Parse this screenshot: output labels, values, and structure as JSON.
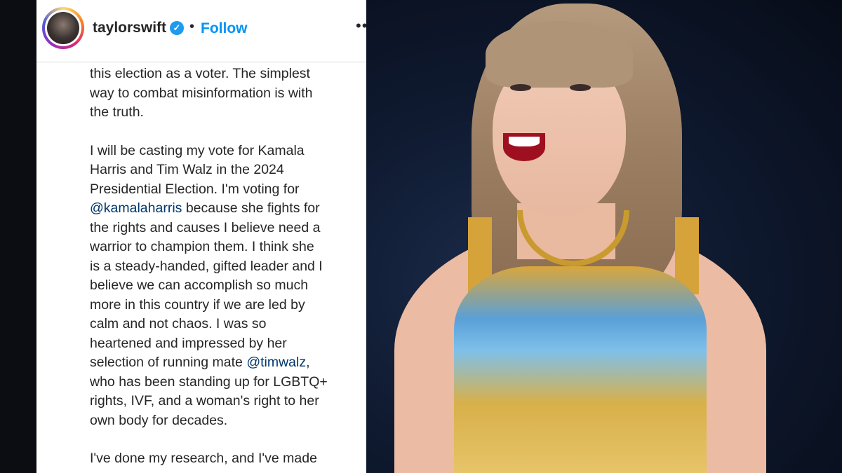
{
  "post": {
    "username": "taylorswift",
    "verified_icon": "verified-badge-icon",
    "separator": "•",
    "follow_label": "Follow",
    "more_icon": "more-options-icon",
    "caption_lines": [
      [
        "this election as a voter. The simplest",
        "way to combat misinformation is with",
        "the truth."
      ],
      [
        "I will be casting my vote for Kamala",
        "Harris and Tim Walz in the 2024",
        "Presidential Election. I'm voting for"
      ]
    ],
    "mention_kamala": "@kamalaharris",
    "after_kamala": " because she fights for",
    "para2_rest": [
      "the rights and causes I believe need a",
      "warrior to champion them. I think she",
      "is a steady-handed, gifted leader and I",
      "believe we can accomplish so much",
      "more in this country if we are led by",
      "calm and not chaos. I was so",
      "heartened and impressed by her"
    ],
    "before_walz": "selection of running mate ",
    "mention_walz": "@timwalz",
    "after_walz": ",",
    "para2_end": [
      "who has been standing up for LGBTQ+",
      "rights, IVF, and a woman's right to her",
      "own body for decades."
    ],
    "para3_start": "I've done my research, and I've made"
  },
  "colors": {
    "link": "#00376b",
    "follow": "#0095f6",
    "text": "#262626"
  }
}
